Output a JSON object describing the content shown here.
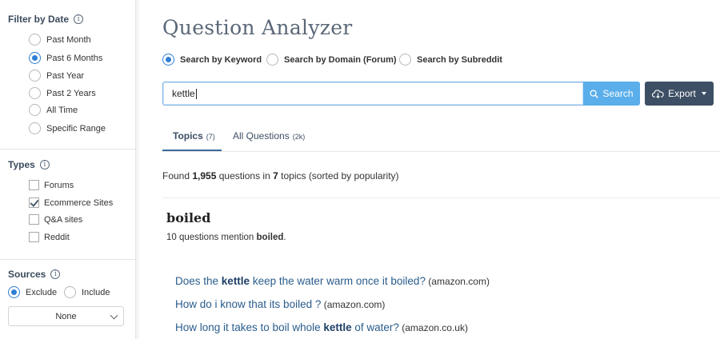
{
  "sidebar": {
    "date_filter": {
      "title": "Filter by Date",
      "options": [
        {
          "label": "Past Month",
          "selected": false
        },
        {
          "label": "Past 6 Months",
          "selected": true
        },
        {
          "label": "Past Year",
          "selected": false
        },
        {
          "label": "Past 2 Years",
          "selected": false
        },
        {
          "label": "All Time",
          "selected": false
        },
        {
          "label": "Specific Range",
          "selected": false
        }
      ]
    },
    "types": {
      "title": "Types",
      "options": [
        {
          "label": "Forums",
          "checked": false
        },
        {
          "label": "Ecommerce Sites",
          "checked": true
        },
        {
          "label": "Q&A sites",
          "checked": false
        },
        {
          "label": "Reddit",
          "checked": false
        }
      ]
    },
    "sources": {
      "title": "Sources",
      "exclude_label": "Exclude",
      "include_label": "Include",
      "selected": "Exclude",
      "select_value": "None"
    },
    "info_icon_glyph": "i"
  },
  "main": {
    "title": "Question Analyzer",
    "modes": [
      {
        "label": "Search by Keyword",
        "selected": true
      },
      {
        "label": "Search by Domain (Forum)",
        "selected": false
      },
      {
        "label": "Search by Subreddit",
        "selected": false
      }
    ],
    "search": {
      "value": "kettle",
      "button_label": "Search",
      "export_label": "Export"
    },
    "tabs": [
      {
        "label": "Topics",
        "count": "(7)",
        "active": true
      },
      {
        "label": "All Questions",
        "count": "(2k)",
        "active": false
      }
    ],
    "found": {
      "prefix": "Found ",
      "count": "1,955",
      "middle": " questions in ",
      "topics": "7",
      "suffix": " topics (sorted by popularity)"
    },
    "topic": {
      "title": "boiled",
      "mention_prefix": "10 questions mention ",
      "mention_word": "boiled",
      "mention_suffix": "."
    },
    "questions": [
      {
        "pre": "Does the ",
        "kw": "kettle",
        "post": " keep the water warm once it boiled?",
        "source": " (amazon.com)"
      },
      {
        "pre": "How do i know that its boiled ?",
        "kw": "",
        "post": "",
        "source": " (amazon.com)"
      },
      {
        "pre": "How long it takes to boil whole ",
        "kw": "kettle",
        "post": " of water?",
        "source": " (amazon.co.uk)"
      }
    ]
  },
  "colors": {
    "accent": "#2f7fd6",
    "search_button": "#5aaeea",
    "export_button": "#3d4f64",
    "link": "#2a5c8c"
  }
}
